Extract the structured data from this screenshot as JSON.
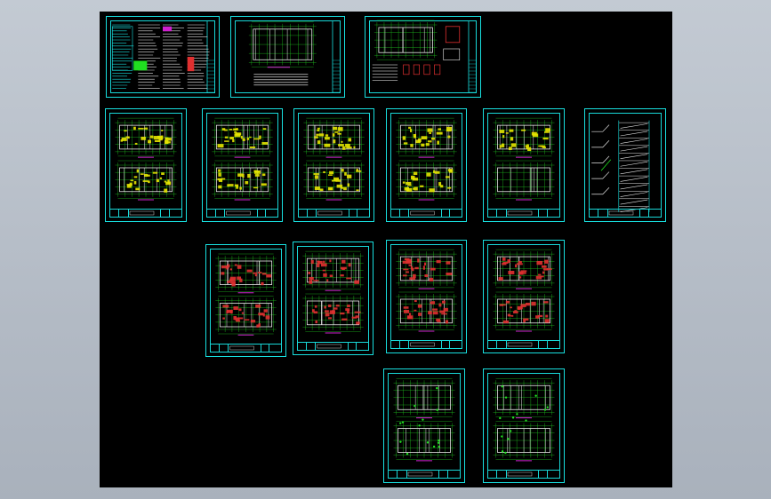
{
  "app": {
    "title": "",
    "canvas_background": "#000000",
    "frame_color": "#18e0e0"
  },
  "sheets": [
    {
      "id": "index-sheet",
      "kind": "notes"
    },
    {
      "id": "site-plan-sheet",
      "kind": "plan-single"
    },
    {
      "id": "detail-sheet",
      "kind": "details"
    },
    {
      "id": "floor-plan-1",
      "kind": "plan-double-yellow"
    },
    {
      "id": "floor-plan-2",
      "kind": "plan-double-yellow"
    },
    {
      "id": "floor-plan-3",
      "kind": "plan-double-yellow"
    },
    {
      "id": "floor-plan-4",
      "kind": "plan-double-yellow"
    },
    {
      "id": "floor-plan-5",
      "kind": "plan-double-sparse"
    },
    {
      "id": "stair-section-sheet",
      "kind": "stair"
    },
    {
      "id": "elec-plan-1",
      "kind": "plan-double-red"
    },
    {
      "id": "elec-plan-2",
      "kind": "plan-double-red"
    },
    {
      "id": "elec-plan-3",
      "kind": "plan-double-red"
    },
    {
      "id": "elec-plan-4",
      "kind": "plan-double-red"
    },
    {
      "id": "roof-plan-1",
      "kind": "plan-double-green"
    },
    {
      "id": "roof-plan-2",
      "kind": "plan-double-green"
    }
  ],
  "colors": {
    "frame": "#18e0e0",
    "wall": "#e8e8e8",
    "axis": "#20c020",
    "hatch_yellow": "#e6e600",
    "hatch_red": "#e03030",
    "accent_magenta": "#d020d0",
    "accent_green": "#20e020"
  }
}
